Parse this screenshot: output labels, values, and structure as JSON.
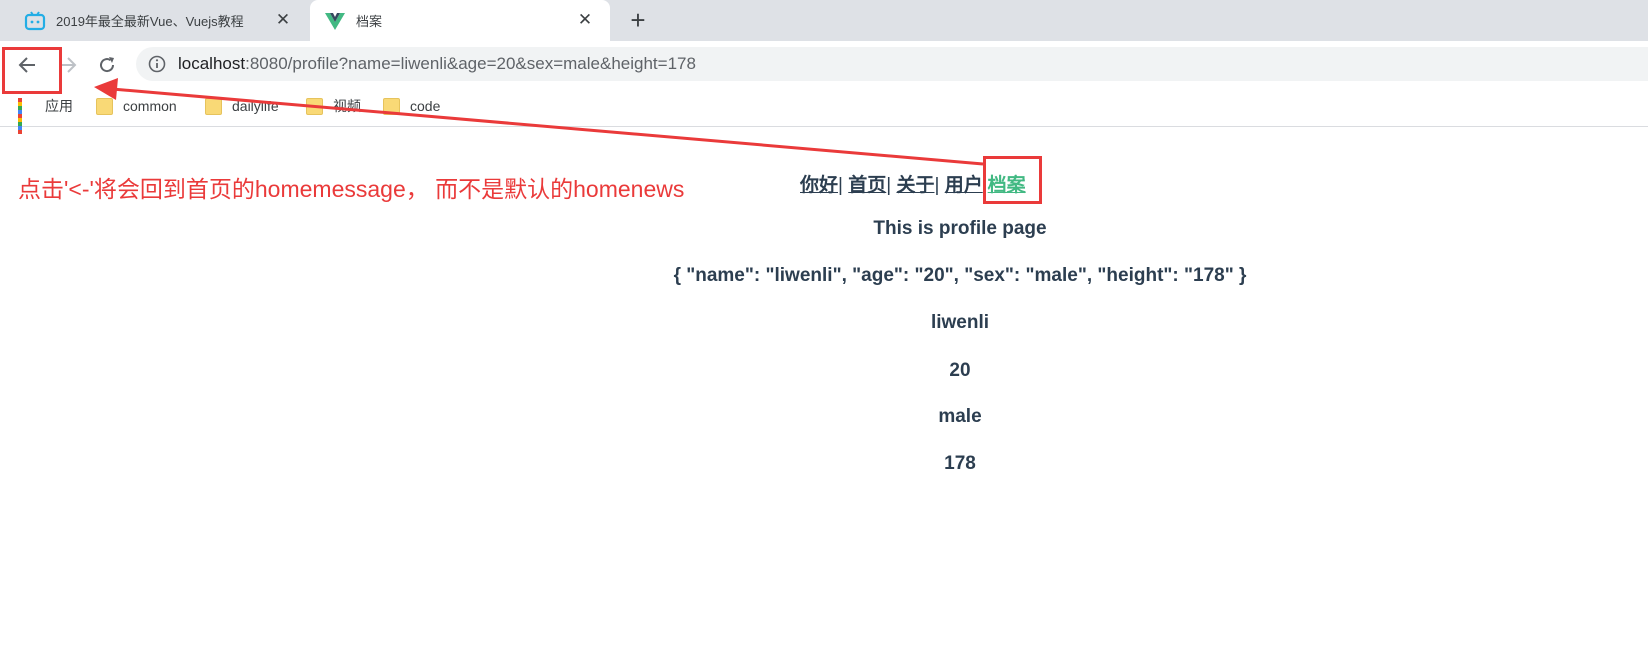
{
  "browser": {
    "tabs": [
      {
        "title": "2019年最全最新Vue、Vuejs教程",
        "active": false,
        "favicon": "bilibili-icon"
      },
      {
        "title": "档案",
        "active": true,
        "favicon": "vue-icon"
      }
    ],
    "new_tab_icon": "plus-icon",
    "close_icon": "close-icon",
    "address_bar": {
      "host": "localhost",
      "rest": ":8080/profile?name=liwenli&age=20&sex=male&height=178"
    },
    "nav_icons": [
      "back-arrow-icon",
      "forward-arrow-icon",
      "reload-icon"
    ],
    "bookmarks": [
      {
        "label": "应用",
        "icon": "apps-grid-icon"
      },
      {
        "label": "common",
        "icon": "folder-icon"
      },
      {
        "label": "dailylife",
        "icon": "folder-icon"
      },
      {
        "label": "视频",
        "icon": "folder-icon"
      },
      {
        "label": "code",
        "icon": "folder-icon"
      }
    ]
  },
  "annotation": {
    "text": "点击'<-'将会回到首页的homemessage， 而不是默认的homenews",
    "color": "#ea3a3a"
  },
  "app": {
    "nav": [
      {
        "label": "你好",
        "active": false
      },
      {
        "label": "首页",
        "active": false
      },
      {
        "label": "关于",
        "active": false
      },
      {
        "label": "用户",
        "active": false
      },
      {
        "label": "档案",
        "active": true
      }
    ],
    "separator": "|",
    "heading": "This is profile page",
    "query_json": "{ \"name\": \"liwenli\", \"age\": \"20\", \"sex\": \"male\", \"height\": \"178\" }",
    "values": [
      "liwenli",
      "20",
      "male",
      "178"
    ],
    "text_color": "#2c3e50",
    "active_color": "#42b983"
  }
}
